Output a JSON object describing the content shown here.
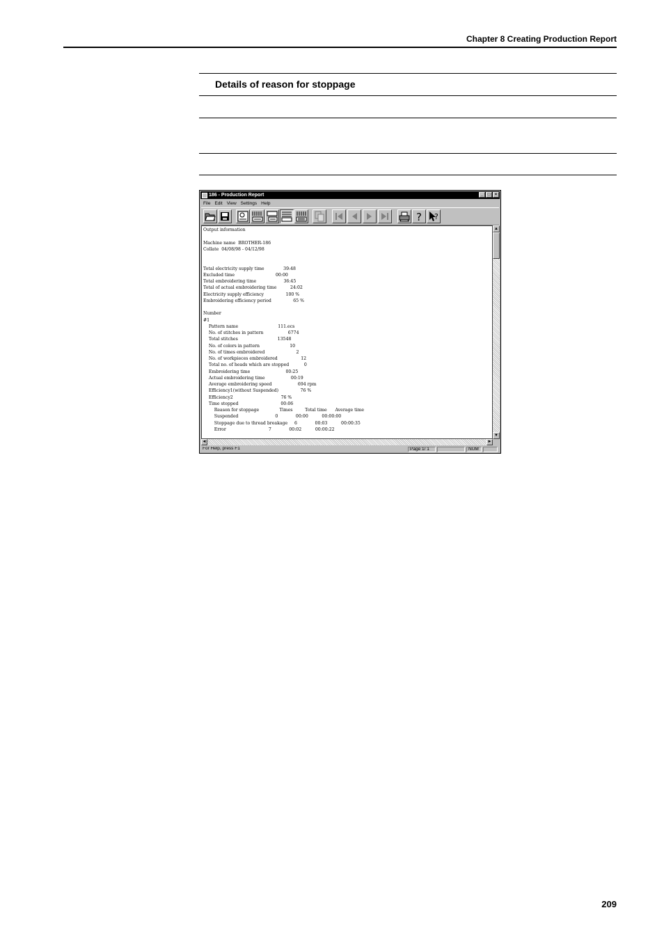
{
  "page": {
    "chapter_header": "Chapter 8  Creating Production Report",
    "section_title": "Details of reason for stoppage",
    "page_number": "209"
  },
  "window": {
    "title": "186 - Production Report",
    "menu": [
      "File",
      "Edit",
      "View",
      "Settings",
      "Help"
    ],
    "toolbar_icons": [
      "open-icon",
      "save-icon",
      "view-icon",
      "report-view-1-icon",
      "report-view-2-icon",
      "report-view-3-icon",
      "report-view-4-icon",
      "copy-icon",
      "first-page-icon",
      "prev-page-icon",
      "next-page-icon",
      "last-page-icon",
      "print-icon",
      "help-icon",
      "context-help-icon"
    ],
    "report_lines": [
      "Output information",
      "",
      "Machine name  BROTHER-186",
      "Collate  04/08/98 - 04/12/98",
      "",
      "",
      "Total electricity supply time              39:48",
      "Excluded time                              00:00",
      "Total embroidering time                    36:45",
      "Total of actual embroidering time          24:02",
      "Electricity supply efficiency                100 %",
      "Embroidering efficiency period                65 %",
      "",
      "Number",
      "#1",
      "    Pattern name                             111.ecs",
      "    No. of stitches in pattern                  6774",
      "    Total stitches                             13548",
      "    No. of colors in pattern                      10",
      "    No. of times embroidered                       2",
      "    No. of workpieces embroidered                 12",
      "    Total no. of heads which are stopped           0",
      "    Embroidering time                          00:25",
      "    Actual embroidering time                   00:19",
      "    Average embroidering speed                   694 rpm",
      "    Efficiency1(without Suspended)                76 %",
      "    Efficiency2                                   76 %",
      "    Time stopped                               00:06",
      "        Reason for stoppage               Times         Total time      Average time",
      "        Suspended                           0             00:00          00:00:00",
      "        Stoppage due to thread breakage     6             00:03          00:00:35",
      "        Error                               7             00:02          00:00:22"
    ],
    "status": {
      "help": "For Help, press F1",
      "page": "Page  1/ 1",
      "num": "NUM"
    }
  }
}
